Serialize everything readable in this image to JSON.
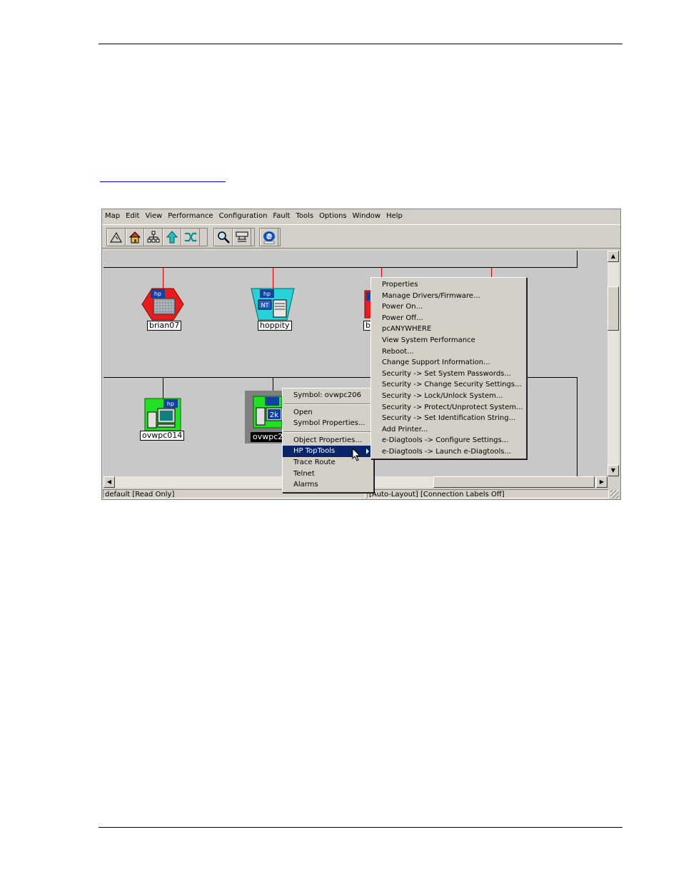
{
  "menubar": [
    "Map",
    "Edit",
    "View",
    "Performance",
    "Configuration",
    "Fault",
    "Tools",
    "Options",
    "Window",
    "Help"
  ],
  "toolbar": {
    "group1_icons": [
      "map-up-icon",
      "home-icon",
      "network-tree-icon",
      "up-arrow-icon",
      "shuffle-icon"
    ],
    "group2_icons": [
      "find-icon",
      "network-status-icon"
    ],
    "group3_icons": [
      "hp-toptools-icon"
    ]
  },
  "map": {
    "nodes": [
      {
        "label": "brian07",
        "color": "#e81c1c",
        "icon": "hp-server-icon"
      },
      {
        "label": "hoppity",
        "color": "#28d0d8",
        "icon": "hp-nt-server-icon"
      },
      {
        "label": "b",
        "color": "#e81c1c",
        "icon": "hp-server-icon"
      },
      {
        "label": "ovwpc014",
        "color": "#22e022",
        "icon": "hp-pc-icon"
      },
      {
        "label": "ovwpc2",
        "color": "#22e022",
        "icon": "hp-pc-2k-icon",
        "icon_text": "2k"
      }
    ]
  },
  "context_menu": {
    "items": [
      {
        "label": "Symbol: ovwpc206",
        "sep_after": true
      },
      {
        "label": "Open"
      },
      {
        "label": "Symbol Properties...",
        "sep_after": true
      },
      {
        "label": "Object Properties..."
      },
      {
        "label": "HP TopTools",
        "highlighted": true,
        "submenu": true
      },
      {
        "label": "Trace Route"
      },
      {
        "label": "Telnet"
      },
      {
        "label": "Alarms"
      }
    ]
  },
  "submenu": {
    "items": [
      "Properties",
      "Manage Drivers/Firmware...",
      "Power On...",
      "Power Off...",
      "pcANYWHERE",
      "View System Performance",
      "Reboot...",
      "Change Support Information...",
      "Security -> Set System Passwords...",
      "Security -> Change Security Settings...",
      "Security -> Lock/Unlock System...",
      "Security -> Protect/Unprotect System...",
      "Security -> Set Identification String...",
      "Add Printer...",
      "e-Diagtools -> Configure Settings...",
      "e-Diagtools -> Launch e-Diagtools..."
    ]
  },
  "statusbar": {
    "left": "default [Read Only]",
    "right": "[Auto-Layout] [Connection Labels Off]"
  },
  "colors": {
    "menu_highlight": "#0a246a",
    "segment_link": "#e00000",
    "window_bg": "#d4d0c8"
  }
}
